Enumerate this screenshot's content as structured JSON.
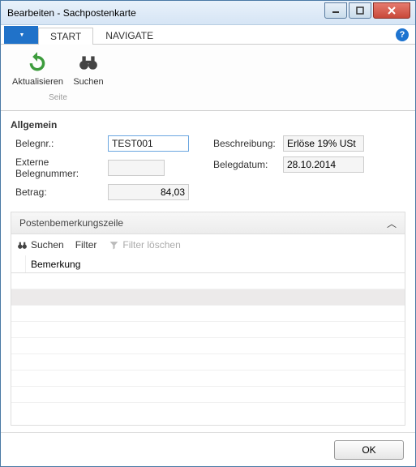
{
  "window": {
    "title": "Bearbeiten - Sachpostenkarte"
  },
  "ribbon": {
    "file_tab": "",
    "tabs": {
      "start": "START",
      "navigate": "NAVIGATE"
    },
    "buttons": {
      "refresh": "Aktualisieren",
      "find": "Suchen"
    },
    "group_label": "Seite"
  },
  "general": {
    "title": "Allgemein",
    "fields": {
      "belegnr_label": "Belegnr.:",
      "belegnr_value": "TEST001",
      "externe_label": "Externe Belegnummer:",
      "externe_value": "",
      "betrag_label": "Betrag:",
      "betrag_value": "84,03",
      "beschreibung_label": "Beschreibung:",
      "beschreibung_value": "Erlöse 19% USt",
      "belegdatum_label": "Belegdatum:",
      "belegdatum_value": "28.10.2014"
    }
  },
  "fasttab": {
    "title": "Postenbemerkungszeile"
  },
  "list_toolbar": {
    "find": "Suchen",
    "filter": "Filter",
    "clear": "Filter löschen"
  },
  "grid": {
    "col_bemerkung": "Bemerkung"
  },
  "footer": {
    "ok": "OK"
  }
}
